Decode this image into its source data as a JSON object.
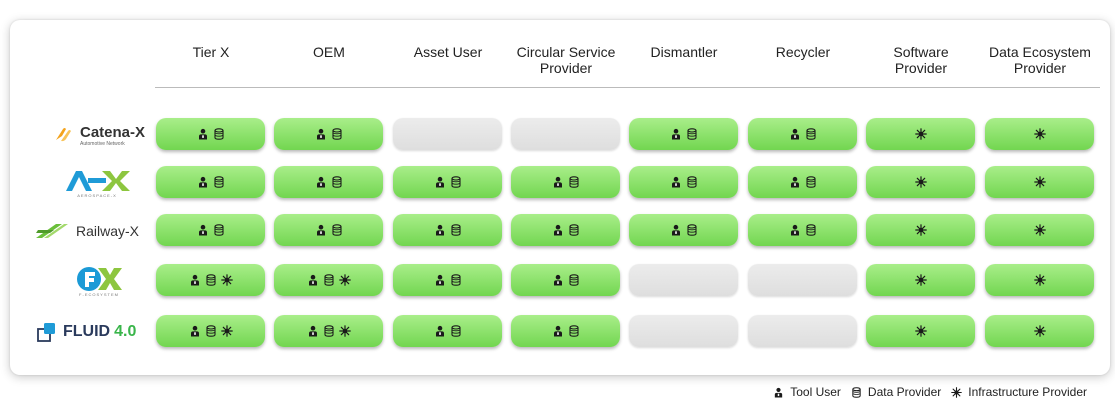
{
  "columns": [
    "Tier X",
    "OEM",
    "Asset User",
    "Circular Service\nProvider",
    "Dismantler",
    "Recycler",
    "Software\nProvider",
    "Data Ecosystem\nProvider"
  ],
  "rows": [
    {
      "id": "catena-x",
      "logo_text": "Catena-X",
      "logo_subtext": "Automotive Network",
      "cells": [
        [
          "tool",
          "data"
        ],
        [
          "tool",
          "data"
        ],
        [],
        [],
        [
          "tool",
          "data"
        ],
        [
          "tool",
          "data"
        ],
        [
          "infra"
        ],
        [
          "infra"
        ]
      ]
    },
    {
      "id": "aerospace-x",
      "logo_text": "A-X",
      "logo_subtext": "AEROSPACE-X",
      "cells": [
        [
          "tool",
          "data"
        ],
        [
          "tool",
          "data"
        ],
        [
          "tool",
          "data"
        ],
        [
          "tool",
          "data"
        ],
        [
          "tool",
          "data"
        ],
        [
          "tool",
          "data"
        ],
        [
          "infra"
        ],
        [
          "infra"
        ]
      ]
    },
    {
      "id": "railway-x",
      "logo_text": "Railway-X",
      "cells": [
        [
          "tool",
          "data"
        ],
        [
          "tool",
          "data"
        ],
        [
          "tool",
          "data"
        ],
        [
          "tool",
          "data"
        ],
        [
          "tool",
          "data"
        ],
        [
          "tool",
          "data"
        ],
        [
          "infra"
        ],
        [
          "infra"
        ]
      ]
    },
    {
      "id": "fx",
      "logo_text": "FX",
      "logo_subtext": "F-ECOSYSTEM",
      "cells": [
        [
          "tool",
          "data",
          "infra"
        ],
        [
          "tool",
          "data",
          "infra"
        ],
        [
          "tool",
          "data"
        ],
        [
          "tool",
          "data"
        ],
        [],
        [],
        [
          "infra"
        ],
        [
          "infra"
        ]
      ]
    },
    {
      "id": "fluid",
      "logo_text": "FLUID",
      "logo_version": "4.0",
      "cells": [
        [
          "tool",
          "data",
          "infra"
        ],
        [
          "tool",
          "data",
          "infra"
        ],
        [
          "tool",
          "data"
        ],
        [
          "tool",
          "data"
        ],
        [],
        [],
        [
          "infra"
        ],
        [
          "infra"
        ]
      ]
    }
  ],
  "legend": [
    {
      "icon": "tool",
      "label": "Tool User"
    },
    {
      "icon": "data",
      "label": "Data Provider"
    },
    {
      "icon": "infra",
      "label": "Infrastructure Provider"
    }
  ],
  "colors": {
    "active_cell": "#8be36a",
    "inactive_cell": "#e4e4e4",
    "catena_orange": "#f4a31c",
    "ax_blue": "#1f9bd7",
    "ax_green": "#8dc63f",
    "railway_green": "#6abf3a",
    "fx_blue": "#1b9ad6",
    "fluid_navy": "#2a3a5c",
    "fluid_green": "#39b54a"
  }
}
